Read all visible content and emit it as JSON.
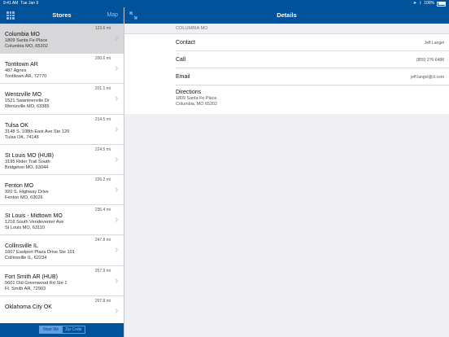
{
  "status_bar": {
    "time": "9:41 AM",
    "date": "Tue Jan 9",
    "battery": "100%",
    "icons": [
      "location-arrow-icon",
      "bluetooth-icon",
      "battery-icon"
    ]
  },
  "master": {
    "title": "Stores",
    "map_label": "Map",
    "left_icon": "grid-icon",
    "stores": [
      {
        "name": "Columbia MO",
        "street": "1809 Santa Fe Place",
        "city": "Columbia MO, 65202",
        "distance": "123.6 mi",
        "selected": true
      },
      {
        "name": "Tontitown AR",
        "street": "487 Agnes",
        "city": "Tontitown AR, 72770",
        "distance": "200.6 mi"
      },
      {
        "name": "Wentzville MO",
        "street": "1521 Swantnerville Dr",
        "city": "Wentzville MO, 63385",
        "distance": "201.1 mi"
      },
      {
        "name": "Tulsa OK",
        "street": "3148 S. 108th East Ave Ste 120",
        "city": "Tulsa OK, 74146",
        "distance": "214.5 mi"
      },
      {
        "name": "St Louis MO (HUB)",
        "street": "3195 Rider Trail South",
        "city": "Bridgeton MO, 63044",
        "distance": "224.5 mi"
      },
      {
        "name": "Fenton MO",
        "street": "920 S. Highway Drive",
        "city": "Fenton MO, 63026",
        "distance": "226.2 mi"
      },
      {
        "name": "St Louis - Midtown MO",
        "street": "1216 South Vendeventer Ave",
        "city": "St Louis MO, 63110",
        "distance": "236.4 mi"
      },
      {
        "name": "Collinsville IL",
        "street": "1607 Eastport Plaza Drive Ste 101",
        "city": "Collinsville IL, 62234",
        "distance": "247.8 mi"
      },
      {
        "name": "Fort Smith AR (HUB)",
        "street": "5601 Old Greenwood Rd Ste 1",
        "city": "Ft. Smith AR, 72903",
        "distance": "257.9 mi"
      },
      {
        "name": "Oklahoma City OK",
        "street": "",
        "city": "",
        "distance": "297.8 mi"
      }
    ],
    "segments": [
      "Near Me",
      "Zip Code"
    ],
    "active_segment": "Near Me"
  },
  "detail": {
    "title": "Details",
    "expand_icon": "expand-arrows-icon",
    "section_header": "COLUMBIA MO",
    "contact_label": "Contact",
    "contact_value": "Jeff Langel",
    "call_label": "Call",
    "call_value": "(855) 276-6488",
    "email_label": "Email",
    "email_value": "jeff.langel@cl.com",
    "directions_label": "Directions",
    "directions_street": "1809 Santa Fe Place",
    "directions_city": "Columbia, MO 65202"
  }
}
